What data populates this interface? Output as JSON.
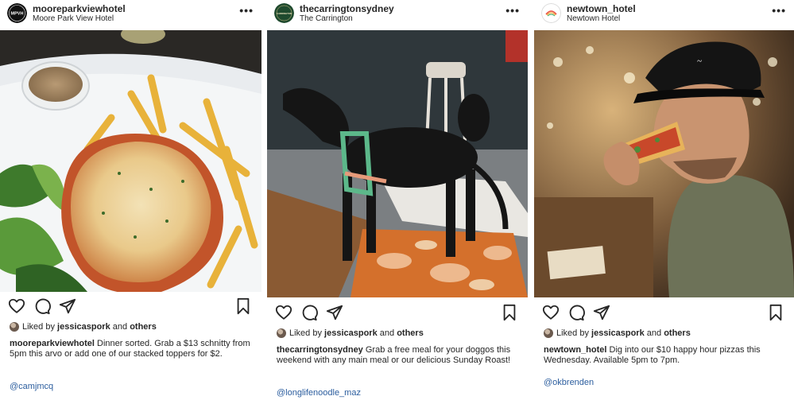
{
  "posts": [
    {
      "username": "mooreparkviewhotel",
      "location": "Moore Park View Hotel",
      "more_label": "•••",
      "avatar_text": "MPVH",
      "likes_prefix": "Liked by",
      "liked_by": "jessicaspork",
      "likes_and": "and",
      "likes_others": "others",
      "caption_user": "mooreparkviewhotel",
      "caption_text": "Dinner sorted. Grab a $13 schnitty from 5pm this arvo or add one of our stacked toppers for $2.",
      "credit": "@camjmcq",
      "photo_subject": "chicken-parmigiana-with-chips-and-salad"
    },
    {
      "username": "thecarringtonsydney",
      "location": "The Carrington",
      "more_label": "•••",
      "avatar_text": "CARRINGTON",
      "likes_prefix": "Liked by",
      "liked_by": "jessicaspork",
      "likes_and": "and",
      "likes_others": "others",
      "caption_user": "thecarringtonsydney",
      "caption_text": "Grab a free meal for your doggos this weekend with any main meal or our delicious Sunday Roast!",
      "credit": "@longlifenoodle_maz",
      "photo_subject": "black-greyhound-on-mat"
    },
    {
      "username": "newtown_hotel",
      "location": "Newtown Hotel",
      "more_label": "•••",
      "avatar_text": "",
      "likes_prefix": "Liked by",
      "liked_by": "jessicaspork",
      "likes_and": "and",
      "likes_others": "others",
      "caption_user": "newtown_hotel",
      "caption_text": "Dig into our $10 happy hour pizzas this Wednesday. Available 5pm to 7pm.",
      "credit": "@okbrenden",
      "photo_subject": "man-eating-pizza-slice"
    }
  ],
  "icons": {
    "like": "heart-icon",
    "comment": "comment-icon",
    "share": "send-icon",
    "save": "bookmark-icon",
    "more": "more-options-icon"
  },
  "colors": {
    "text": "#262626",
    "link": "#2b5d9e",
    "background": "#ffffff"
  }
}
